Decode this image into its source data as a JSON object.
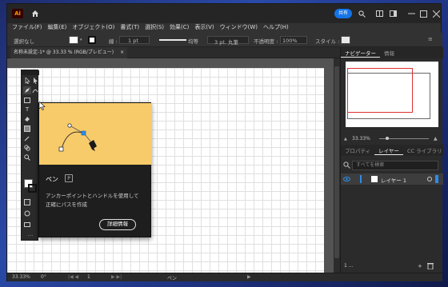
{
  "app": {
    "logo": "Ai",
    "share_label": "共有"
  },
  "menu": [
    "ファイル(F)",
    "編集(E)",
    "オブジェクト(O)",
    "書式(T)",
    "選択(S)",
    "効果(C)",
    "表示(V)",
    "ウィンドウ(W)",
    "ヘルプ(H)"
  ],
  "control_bar": {
    "selection": "選択なし",
    "stroke_label": "線 :",
    "stroke_value": "1 pt",
    "profile_label": "均等",
    "brush_label": "3 pt. 丸筆",
    "opacity_label": "不透明度 :",
    "opacity_value": "100%",
    "style_label": "スタイル :"
  },
  "document_tab": {
    "label": "名称未設定-1* @ 33.33 % (RGB/プレビュー)",
    "close": "×"
  },
  "tooltip": {
    "title": "ペン",
    "shortcut": "P",
    "description_line1": "アンカーポイントとハンドルを使用して",
    "description_line2": "正確にパスを作成",
    "button_label": "詳細情報"
  },
  "panels": {
    "top_tabs": [
      "ナビゲーター",
      "情報"
    ],
    "navigator_zoom": "33.33%",
    "mid_tabs": [
      "プロパティ",
      "レイヤー",
      "CC ライブラリ"
    ],
    "search_placeholder": "すべてを検索",
    "layer_name": "レイヤー 1",
    "layer_count": "1 ..."
  },
  "status": {
    "zoom": "33.33%",
    "rotation": "0°",
    "artboard": "1",
    "tool": "ペン"
  },
  "colors": {
    "accent": "#1473e6",
    "tooltip_art": "#f7cb6a",
    "nav_red": "#e03030"
  }
}
